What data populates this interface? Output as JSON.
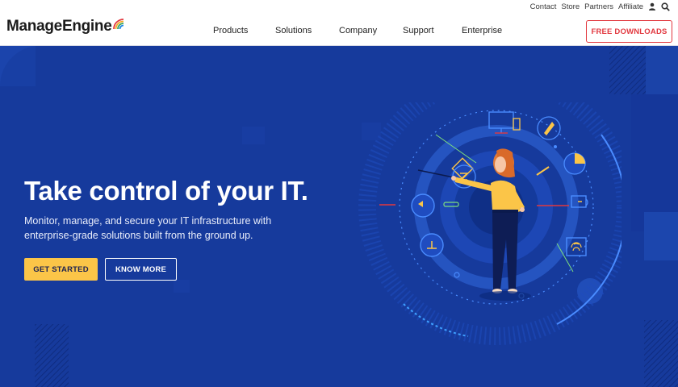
{
  "utility": {
    "links": [
      "Contact",
      "Store",
      "Partners",
      "Affiliate"
    ],
    "icons": [
      "user-icon",
      "search-icon"
    ]
  },
  "brand": {
    "name": "ManageEngine"
  },
  "nav": {
    "items": [
      "Products",
      "Solutions",
      "Company",
      "Support",
      "Enterprise"
    ]
  },
  "header": {
    "cta_label": "FREE DOWNLOADS"
  },
  "hero": {
    "title": "Take control of your IT.",
    "subtitle": "Monitor, manage, and secure your IT infrastructure with enterprise-grade solutions built from the ground up.",
    "primary_button": "GET STARTED",
    "secondary_button": "KNOW MORE"
  },
  "colors": {
    "hero_background": "#163a9c",
    "accent_yellow": "#fbc548",
    "cta_red": "#e2383f",
    "circuit_blue": "#4a8cff"
  }
}
